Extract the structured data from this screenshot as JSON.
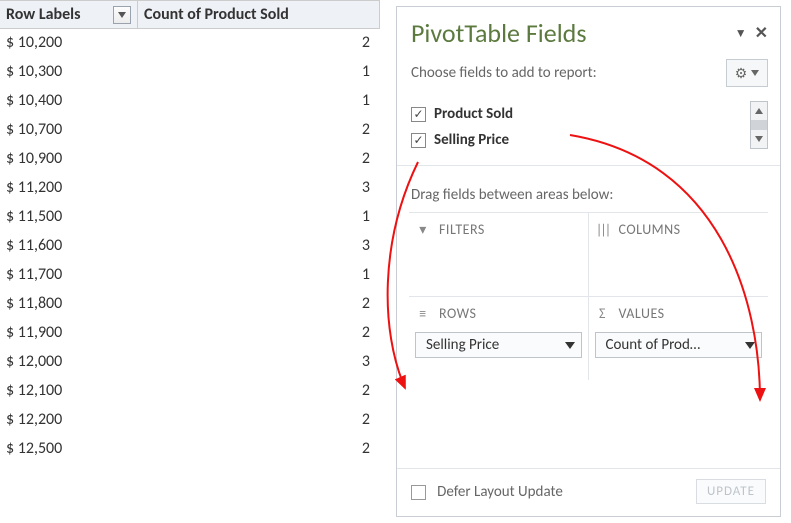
{
  "pivot": {
    "headers": {
      "row_labels": "Row Labels",
      "count": "Count of Product Sold"
    },
    "rows": [
      {
        "label": "$ 10,200",
        "value": "2"
      },
      {
        "label": "$ 10,300",
        "value": "1"
      },
      {
        "label": "$ 10,400",
        "value": "1"
      },
      {
        "label": "$ 10,700",
        "value": "2"
      },
      {
        "label": "$ 10,900",
        "value": "2"
      },
      {
        "label": "$ 11,200",
        "value": "3"
      },
      {
        "label": "$ 11,500",
        "value": "1"
      },
      {
        "label": "$ 11,600",
        "value": "3"
      },
      {
        "label": "$ 11,700",
        "value": "1"
      },
      {
        "label": "$ 11,800",
        "value": "2"
      },
      {
        "label": "$ 11,900",
        "value": "2"
      },
      {
        "label": "$ 12,000",
        "value": "3"
      },
      {
        "label": "$ 12,100",
        "value": "2"
      },
      {
        "label": "$ 12,200",
        "value": "2"
      },
      {
        "label": "$ 12,500",
        "value": "2"
      }
    ]
  },
  "pane": {
    "title": "PivotTable Fields",
    "subtitle": "Choose fields to add to report:",
    "fields": [
      {
        "label": "Product Sold",
        "checked": true
      },
      {
        "label": "Selling Price",
        "checked": true
      }
    ],
    "drag_label": "Drag fields between areas below:",
    "areas": {
      "filters": {
        "header": "FILTERS"
      },
      "columns": {
        "header": "COLUMNS"
      },
      "rows": {
        "header": "ROWS",
        "item": "Selling Price"
      },
      "values": {
        "header": "VALUES",
        "item": "Count of Prod…"
      }
    },
    "defer_label": "Defer Layout Update",
    "update_label": "UPDATE"
  }
}
